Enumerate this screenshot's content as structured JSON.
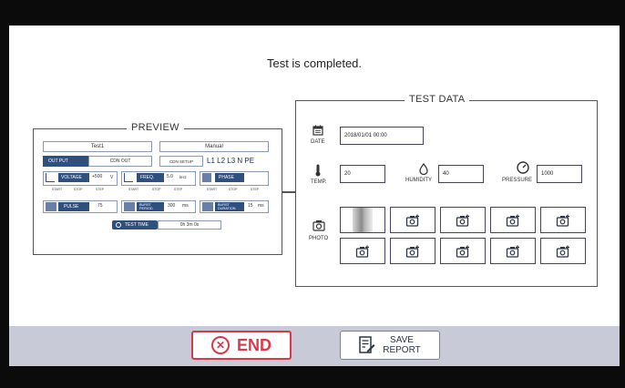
{
  "status_message": "Test is completed.",
  "preview": {
    "title": "PREVIEW",
    "test_name": "Test1",
    "mode": "Manual",
    "output_label": "OUT PUT",
    "output_value": "CDN OUT",
    "cdn_setup_label": "CDN SETUP",
    "lines": "L1 L2 L3  N  PE",
    "voltage_label": "VOLTAGE",
    "voltage_value": "+500",
    "voltage_unit": "V",
    "freq_label": "FREQ.",
    "freq_value": "5.0",
    "freq_unit": "kHz",
    "phase_label": "PHASE",
    "start": "START",
    "stop": "STOP",
    "step": "STEP",
    "pulse_label": "PULSE",
    "pulse_value": "75",
    "burst_period_label": "BURST PERIOD",
    "burst_period_value": "300",
    "burst_period_unit": "ms",
    "burst_duration_label": "BURST DURATION",
    "burst_duration_value": "15",
    "burst_duration_unit": "ms",
    "test_time_label": "TEST TIME",
    "test_time_value": "0h 3m 0s"
  },
  "test_data": {
    "title": "TEST DATA",
    "date_label": "DATE",
    "date_value": "2018/01/01 00:00",
    "temp_label": "TEMP.",
    "temp_value": "20",
    "humidity_label": "HUMIDITY",
    "humidity_value": "40",
    "pressure_label": "PRESSURE",
    "pressure_value": "1000",
    "photo_label": "PHOTO"
  },
  "footer": {
    "end_label": "END",
    "save_label_line1": "SAVE",
    "save_label_line2": "REPORT"
  },
  "colors": {
    "end_red": "#d8394b",
    "footer_bg": "#c9cad8",
    "preview_blue": "#2f4f7f"
  },
  "icons": [
    "close-circle-icon",
    "report-edit-icon",
    "calendar-icon",
    "thermometer-icon",
    "droplet-icon",
    "gauge-icon",
    "camera-icon",
    "camera-add-icon"
  ]
}
